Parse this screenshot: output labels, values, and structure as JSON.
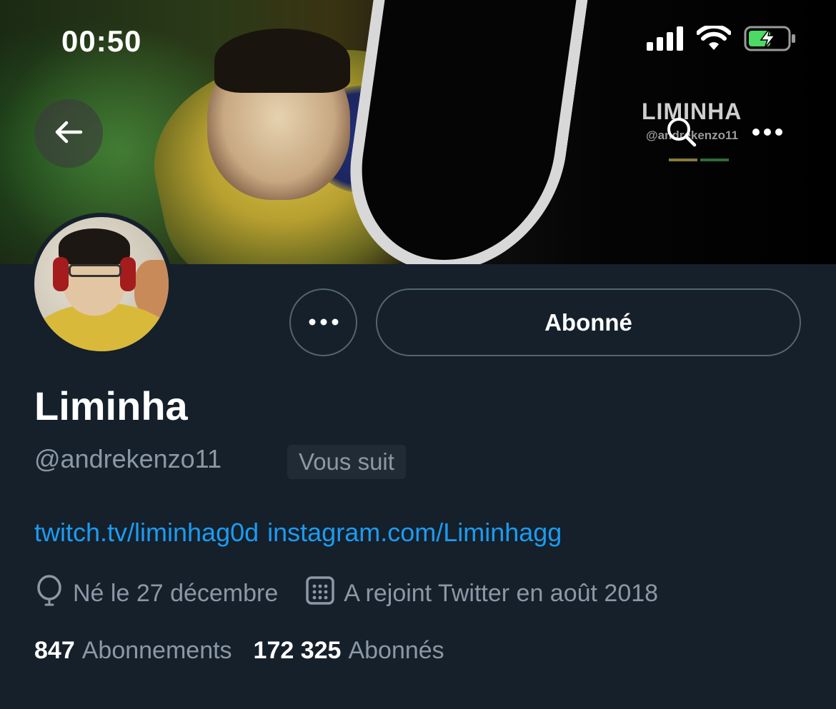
{
  "status_bar": {
    "time": "00:50",
    "icons": [
      "cellular-signal-icon",
      "wifi-icon",
      "battery-charging-icon"
    ],
    "battery_color": "#4cd964"
  },
  "banner": {
    "logo_text": "LIMINHA",
    "logo_handle": "@andrekenzo11",
    "nav": [
      "back-arrow-icon",
      "search-icon",
      "more-horizontal-icon"
    ]
  },
  "profile": {
    "display_name": "Liminha",
    "handle": "@andrekenzo11",
    "follows_you_badge": "Vous suit",
    "follow_button_label": "Abonné",
    "bio_links": [
      "twitch.tv/liminhag0d",
      "instagram.com/Liminhagg"
    ],
    "birthday": "Né le 27 décembre",
    "joined": "A rejoint Twitter en août 2018",
    "following_count": "847",
    "following_label": "Abonnements",
    "followers_count": "172 325",
    "followers_label": "Abonnés"
  },
  "colors": {
    "background": "#15202b",
    "link": "#1d9bf0",
    "secondary_text": "#8b98a5",
    "border": "#536471"
  }
}
